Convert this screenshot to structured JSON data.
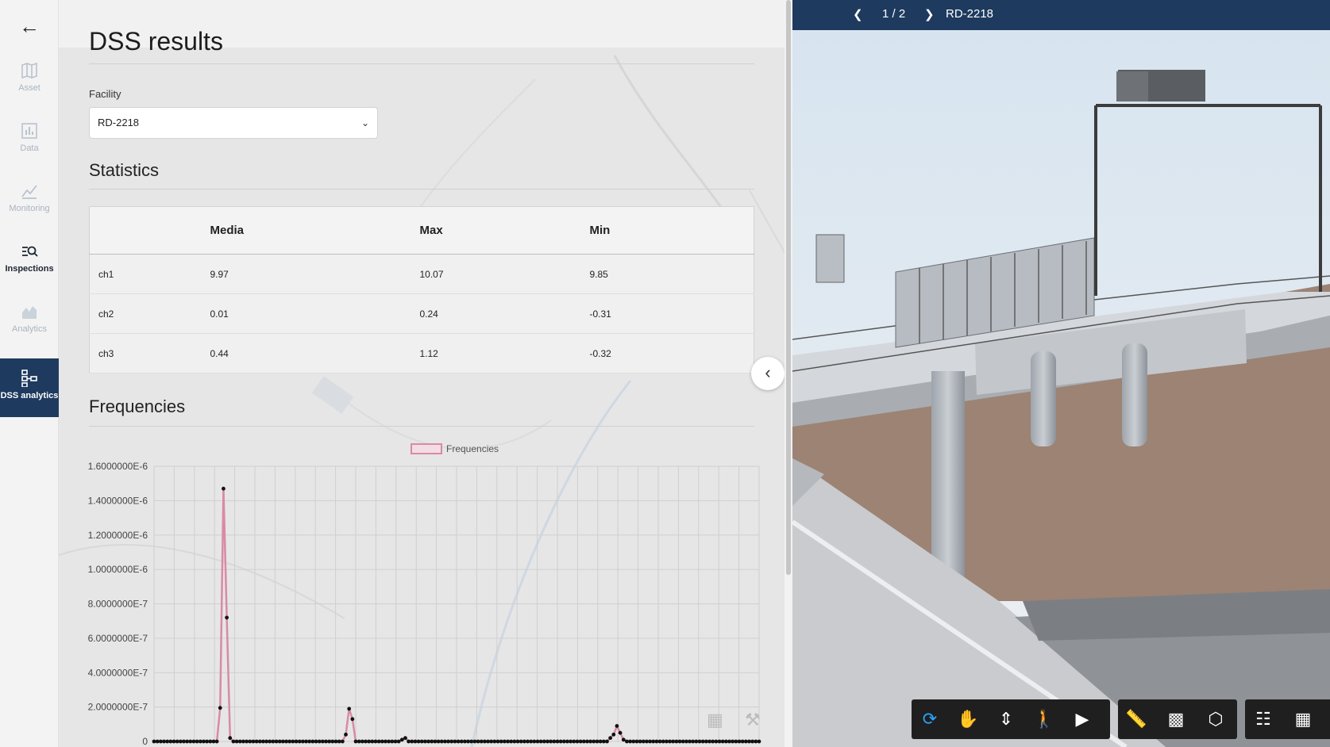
{
  "sidebar": {
    "back_label": "←",
    "items": [
      {
        "label": "Asset",
        "icon": "map-icon"
      },
      {
        "label": "Data",
        "icon": "bar-chart-icon"
      },
      {
        "label": "Monitoring",
        "icon": "line-chart-icon"
      },
      {
        "label": "Inspections",
        "icon": "search-list-icon"
      },
      {
        "label": "Analytics",
        "icon": "area-chart-icon"
      },
      {
        "label": "DSS analytics",
        "icon": "hierarchy-icon"
      }
    ],
    "active_index": 5
  },
  "page": {
    "title": "DSS results",
    "facility_label": "Facility",
    "facility_value": "RD-2218",
    "statistics_title": "Statistics",
    "frequencies_title": "Frequencies"
  },
  "statistics": {
    "headers": [
      "",
      "Media",
      "Max",
      "Min"
    ],
    "rows": [
      {
        "name": "ch1",
        "media": "9.97",
        "max": "10.07",
        "min": "9.85"
      },
      {
        "name": "ch2",
        "media": "0.01",
        "max": "0.24",
        "min": "-0.31"
      },
      {
        "name": "ch3",
        "media": "0.44",
        "max": "1.12",
        "min": "-0.32"
      }
    ]
  },
  "chart_data": {
    "type": "line",
    "legend": [
      "Frequencies"
    ],
    "legend_position": "top-center",
    "grid": true,
    "ylim": [
      0,
      1.6e-06
    ],
    "y_ticks": [
      "0",
      "2.0000000E-7",
      "4.0000000E-7",
      "6.0000000E-7",
      "8.0000000E-7",
      "1.0000000E-6",
      "1.2000000E-6",
      "1.4000000E-6",
      "1.6000000E-6"
    ],
    "series": [
      {
        "name": "Frequencies",
        "color": "#d98aa5",
        "values": [
          0,
          0,
          0,
          0,
          0,
          0,
          0,
          0,
          0,
          0,
          0,
          0,
          0,
          0,
          0,
          0,
          0,
          0,
          0,
          0,
          1.95e-07,
          1.47e-06,
          7.2e-07,
          2e-08,
          0,
          0,
          0,
          0,
          0,
          0,
          0,
          0,
          0,
          0,
          0,
          0,
          0,
          0,
          0,
          0,
          0,
          0,
          0,
          0,
          0,
          0,
          0,
          0,
          0,
          0,
          0,
          0,
          0,
          0,
          0,
          0,
          0,
          0,
          4e-08,
          1.9e-07,
          1.3e-07,
          0,
          0,
          0,
          0,
          0,
          0,
          0,
          0,
          0,
          0,
          0,
          0,
          0,
          0,
          1e-08,
          2e-08,
          0,
          0,
          0,
          0,
          0,
          0,
          0,
          0,
          0,
          0,
          0,
          0,
          0,
          0,
          0,
          0,
          0,
          0,
          0,
          0,
          0,
          0,
          0,
          0,
          0,
          0,
          0,
          0,
          0,
          0,
          0,
          0,
          0,
          0,
          0,
          0,
          0,
          0,
          0,
          0,
          0,
          0,
          0,
          0,
          0,
          0,
          0,
          0,
          0,
          0,
          0,
          0,
          0,
          0,
          0,
          0,
          0,
          0,
          0,
          0,
          0,
          2e-08,
          4e-08,
          9e-08,
          5e-08,
          1e-08,
          0,
          0,
          0,
          0,
          0,
          0,
          0,
          0,
          0,
          0,
          0,
          0,
          0,
          0,
          0,
          0,
          0,
          0,
          0,
          0,
          0,
          0,
          0,
          0,
          0,
          0,
          0,
          0,
          0,
          0,
          0,
          0,
          0,
          0,
          0,
          0,
          0,
          0,
          0,
          0,
          0
        ]
      }
    ]
  },
  "viewer": {
    "page_indicator": "1 / 2",
    "model_name": "RD-2218",
    "prev_icon": "chevron-left-icon",
    "next_icon": "chevron-right-icon"
  },
  "toolbar": {
    "groups": [
      [
        "orbit-icon",
        "pan-icon",
        "dolly-icon",
        "walk-icon",
        "camera-icon"
      ],
      [
        "measure-icon",
        "section-icon",
        "explode-icon"
      ],
      [
        "model-tree-icon",
        "properties-icon"
      ]
    ],
    "active_tool": "orbit-icon"
  },
  "colors": {
    "sidebar_active": "#1e3a5f",
    "viewer_bar": "#1e3a5f",
    "series": "#d98aa5",
    "tool_active": "#2aa6ff"
  }
}
